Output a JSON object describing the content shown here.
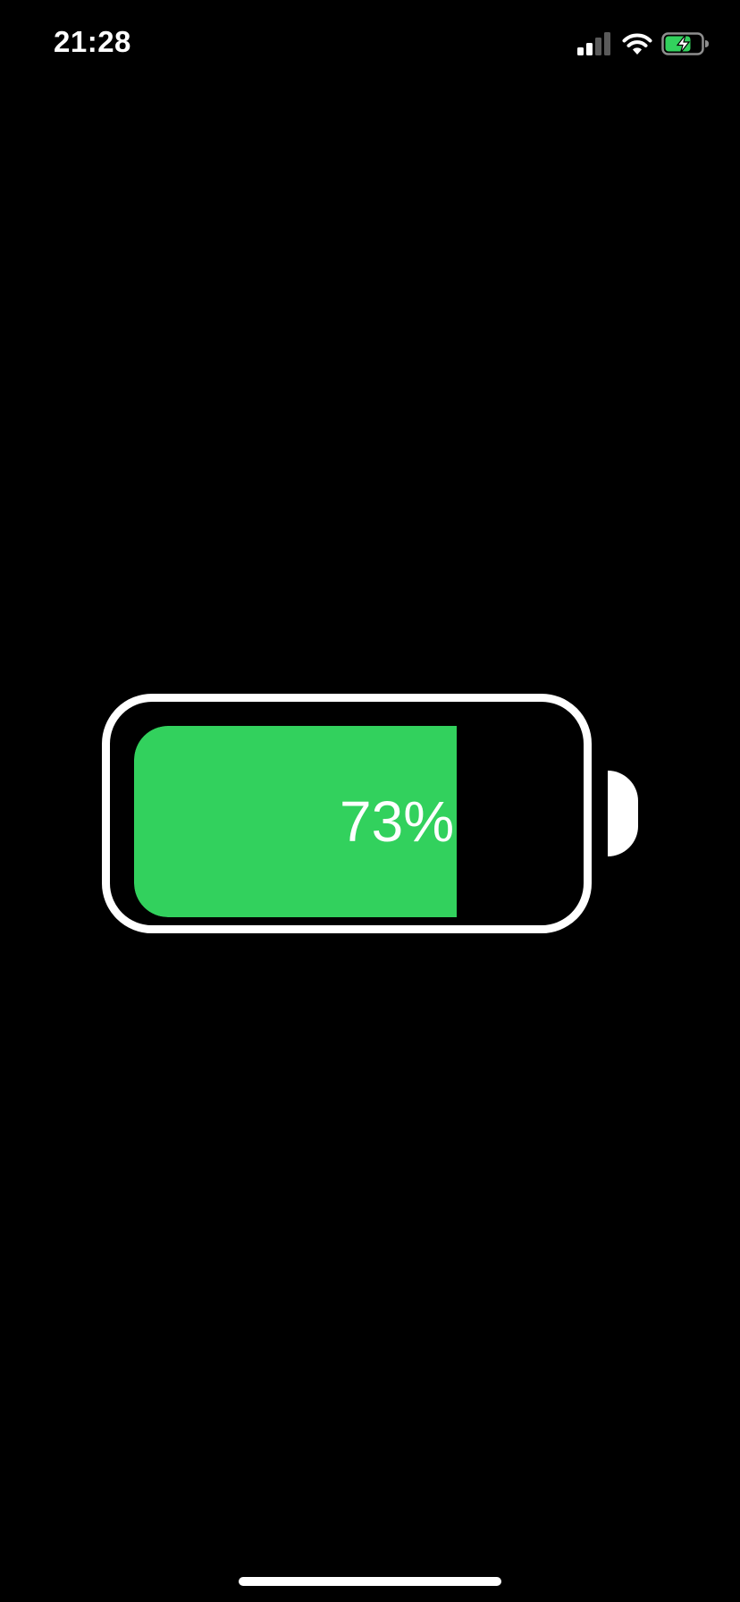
{
  "status_bar": {
    "time": "21:28",
    "icons": [
      "cellular-signal-icon",
      "wifi-icon",
      "battery-charging-icon"
    ],
    "signal_bars_active": 2,
    "signal_bars_total": 4
  },
  "battery": {
    "percent_label": "73%",
    "level": 0.73,
    "charging": true
  },
  "colors": {
    "background": "#000000",
    "battery_fill": "#32d15d",
    "outline": "#ffffff"
  }
}
